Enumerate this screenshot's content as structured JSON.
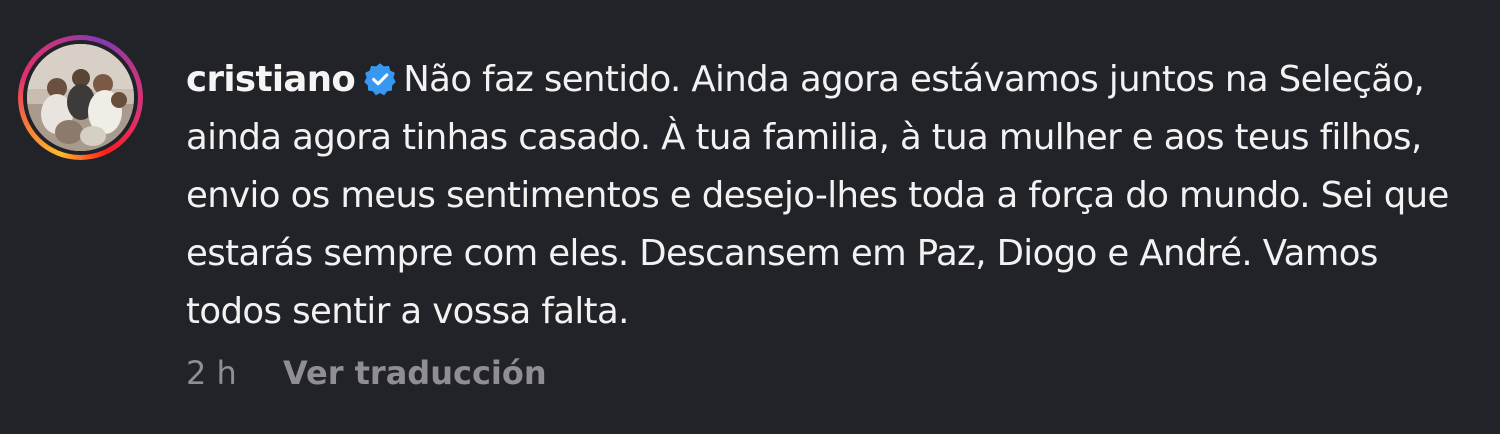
{
  "comment": {
    "username": "cristiano",
    "verified": true,
    "badge_icon": "verified-badge-icon",
    "badge_color": "#3897f0",
    "text": "Não faz sentido. Ainda agora estávamos juntos na Seleção, ainda agora tinhas casado. À tua familia, à tua mulher e aos teus filhos, envio os meus sentimentos e desejo-lhes toda a força do mundo. Sei que estarás sempre com eles. Descansem em Paz, Diogo e André. Vamos todos sentir a vossa falta.",
    "timestamp": "2 h",
    "translate_label": "Ver traducción"
  }
}
